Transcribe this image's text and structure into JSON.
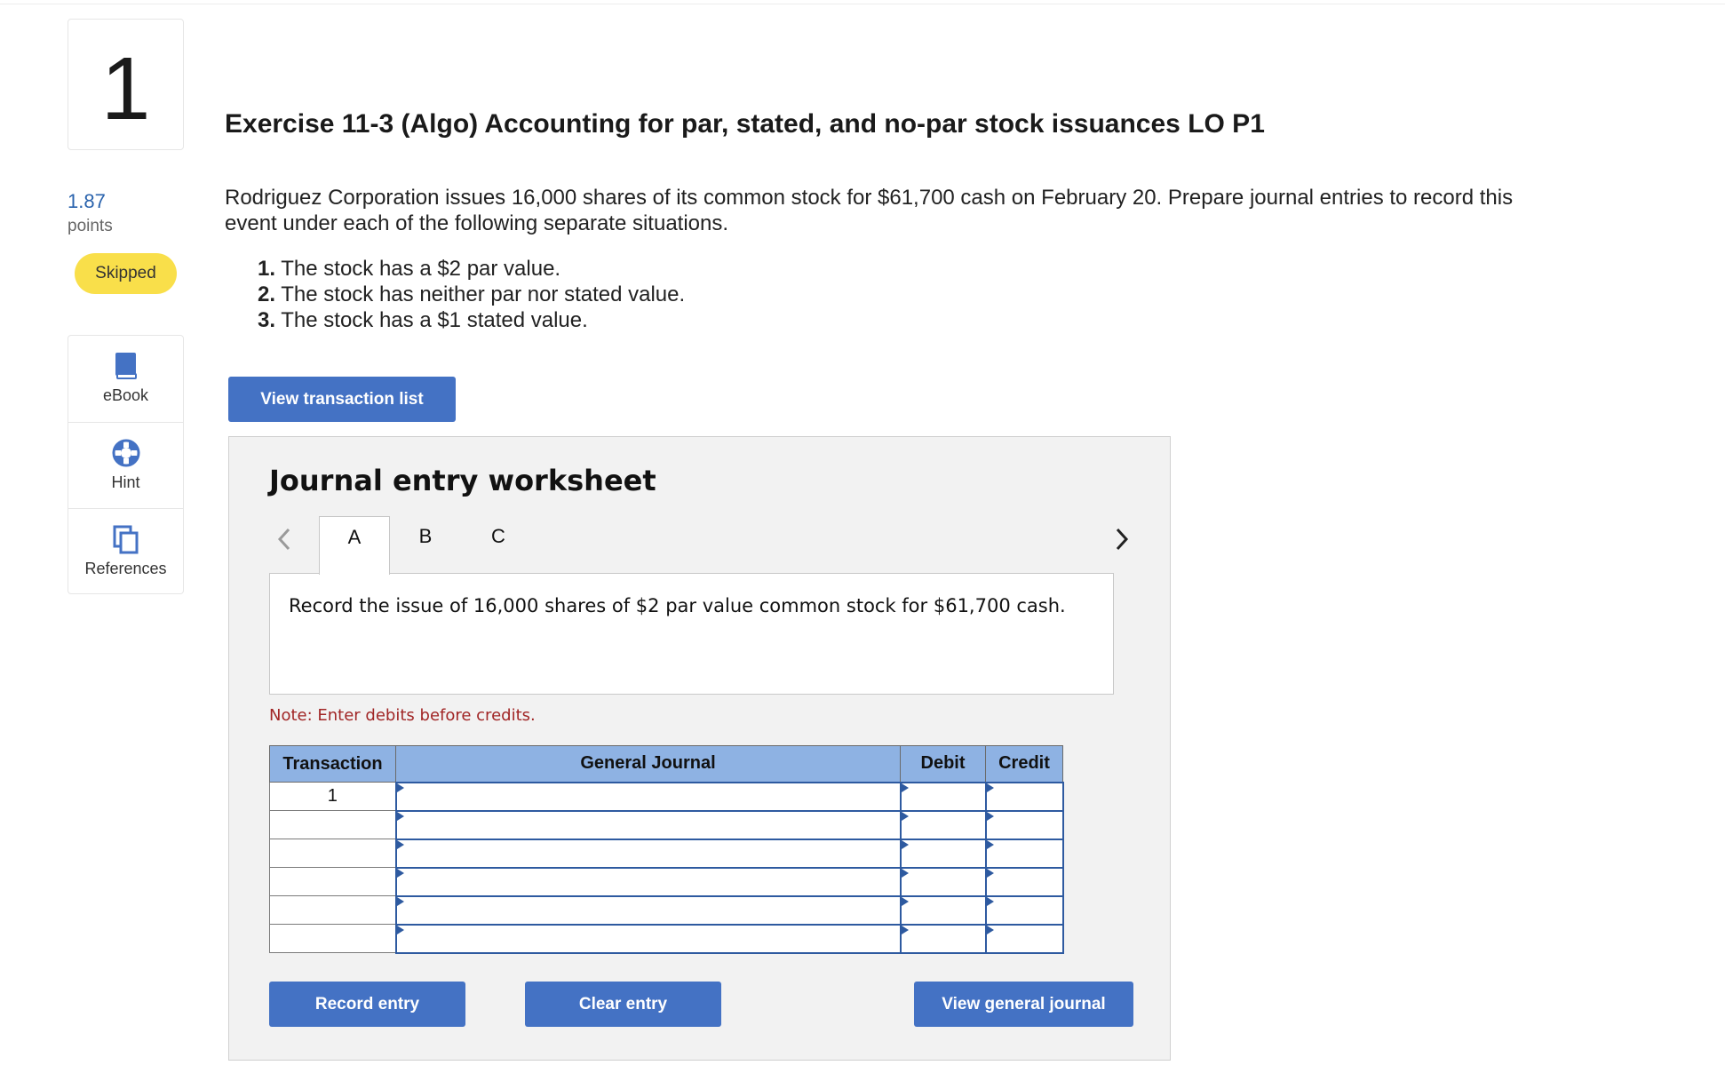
{
  "question": {
    "number": "1",
    "points_value": "1.87",
    "points_label": "points",
    "status": "Skipped"
  },
  "tools": [
    {
      "label": "eBook",
      "icon": "book-icon"
    },
    {
      "label": "Hint",
      "icon": "lifebuoy-icon"
    },
    {
      "label": "References",
      "icon": "copy-pages-icon"
    }
  ],
  "title": "Exercise 11-3 (Algo) Accounting for par, stated, and no-par stock issuances LO P1",
  "intro": "Rodriguez Corporation issues 16,000 shares of its common stock for $61,700 cash on February 20. Prepare journal entries to record this event under each of the following separate situations.",
  "steps": [
    {
      "num": "1.",
      "text": " The stock has a $2 par value."
    },
    {
      "num": "2.",
      "text": " The stock has neither par nor stated value."
    },
    {
      "num": "3.",
      "text": " The stock has a $1 stated value."
    }
  ],
  "view_transaction_list": "View transaction list",
  "worksheet": {
    "title": "Journal entry worksheet",
    "tabs": [
      "A",
      "B",
      "C"
    ],
    "active_tab": "A",
    "description": "Record the issue of 16,000 shares of $2 par value common stock for $61,700 cash.",
    "note": "Note: Enter debits before credits.",
    "columns": [
      "Transaction",
      "General Journal",
      "Debit",
      "Credit"
    ],
    "rows": [
      {
        "transaction": "1",
        "account": "",
        "debit": "",
        "credit": ""
      },
      {
        "transaction": "",
        "account": "",
        "debit": "",
        "credit": ""
      },
      {
        "transaction": "",
        "account": "",
        "debit": "",
        "credit": ""
      },
      {
        "transaction": "",
        "account": "",
        "debit": "",
        "credit": ""
      },
      {
        "transaction": "",
        "account": "",
        "debit": "",
        "credit": ""
      },
      {
        "transaction": "",
        "account": "",
        "debit": "",
        "credit": ""
      }
    ],
    "buttons": {
      "record": "Record entry",
      "clear": "Clear entry",
      "view_journal": "View general journal"
    }
  },
  "colors": {
    "accent_blue": "#4472c4",
    "header_blue": "#8eb2e3",
    "skipped_yellow": "#f9df4a",
    "note_red": "#a12626",
    "points_blue": "#2a63ad"
  }
}
